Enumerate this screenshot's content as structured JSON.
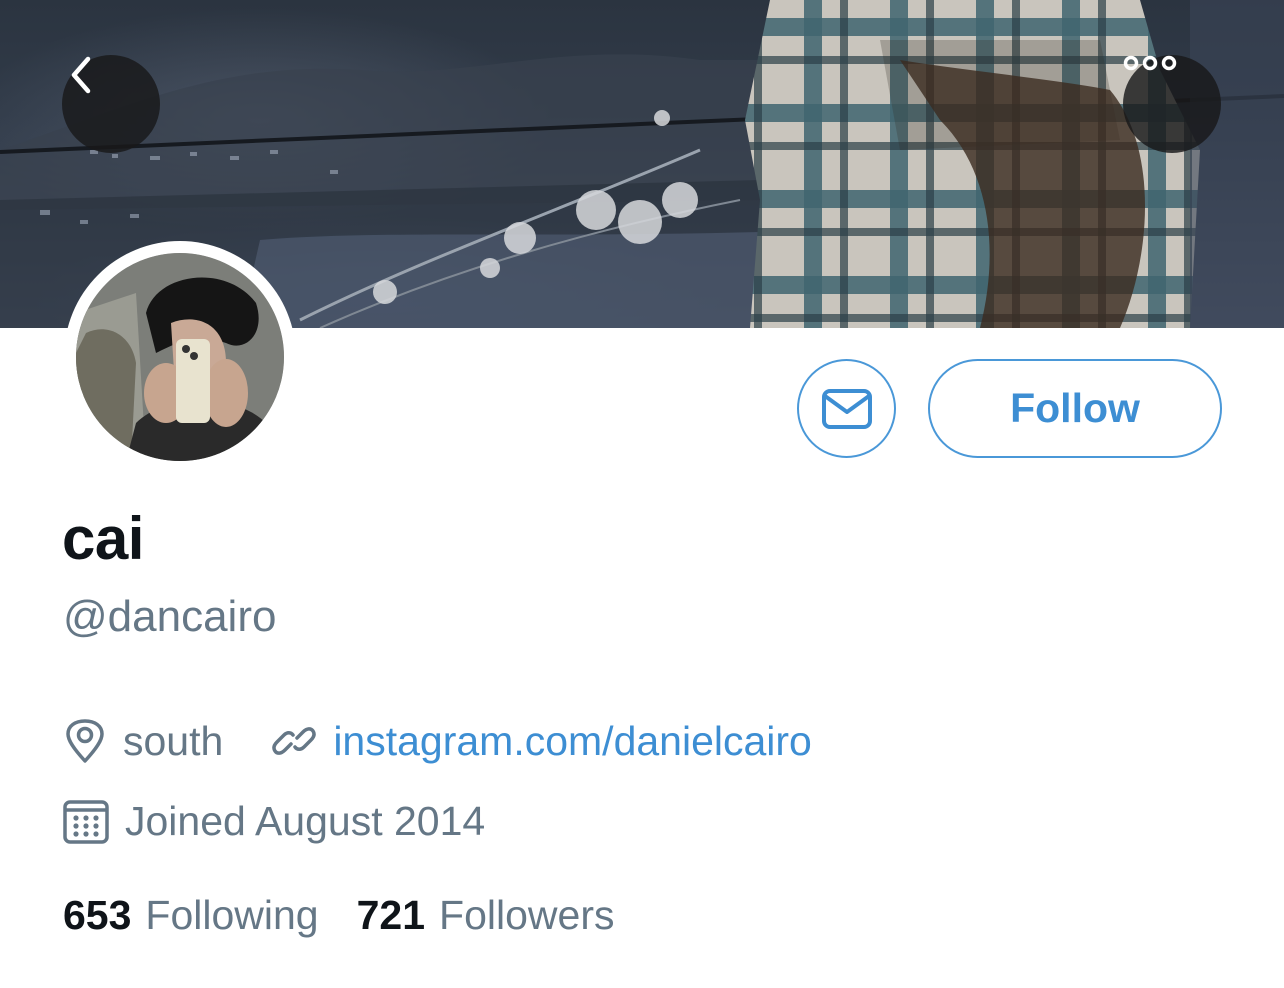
{
  "header": {
    "back_icon": "chevron-left-icon",
    "more_icon": "more-horizontal-icon"
  },
  "profile": {
    "display_name": "cai",
    "handle": "@dancairo",
    "location": "south",
    "location_icon": "map-pin-icon",
    "website": "instagram.com/danielcairo",
    "website_icon": "link-icon",
    "joined": "Joined August 2014",
    "joined_icon": "calendar-icon"
  },
  "actions": {
    "message_icon": "envelope-icon",
    "follow_label": "Follow"
  },
  "stats": {
    "following_count": "653",
    "following_label": "Following",
    "followers_count": "721",
    "followers_label": "Followers"
  },
  "colors": {
    "accent": "#3d8ed3",
    "secondary_text": "#657786",
    "primary_text": "#0f1419",
    "button_overlay": "#18181a"
  }
}
